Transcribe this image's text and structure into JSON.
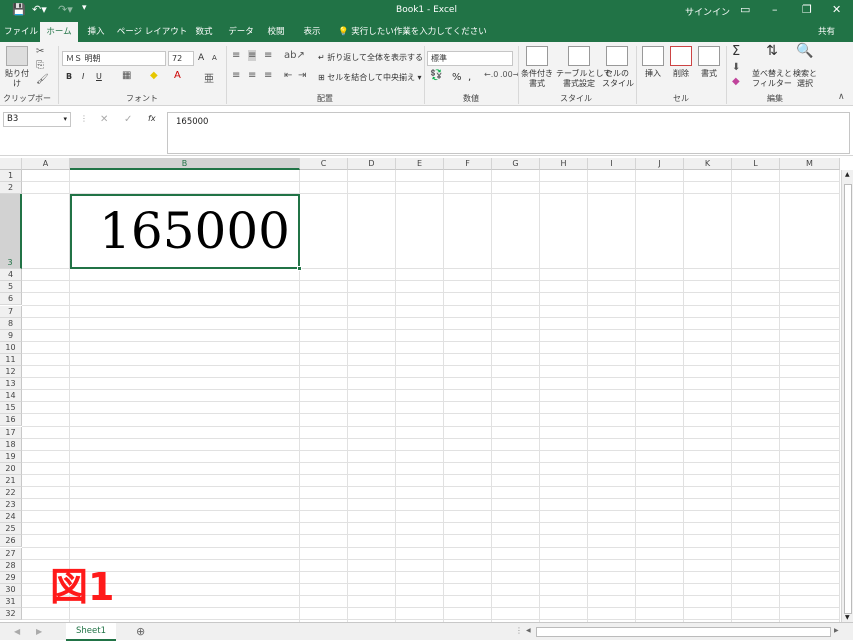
{
  "titlebar": {
    "title": "Book1  -  Excel",
    "signin": "サインイン",
    "save_icon": "save-icon",
    "undo_icon": "undo-icon",
    "redo_icon": "redo-icon",
    "customize_icon": "customize-qat-icon"
  },
  "tabs": [
    "ファイル",
    "ホーム",
    "挿入",
    "ページ レイアウト",
    "数式",
    "データ",
    "校閲",
    "表示"
  ],
  "active_tab": "ホーム",
  "tellme": "実行したい作業を入力してください",
  "share": "共有",
  "ribbon": {
    "clipboard": {
      "label": "クリップボード",
      "paste": "貼り付け"
    },
    "font": {
      "label": "フォント",
      "name": "ＭＳ 明朝",
      "size": "72",
      "bold": "B",
      "italic": "I",
      "underline": "U",
      "grow": "A",
      "shrink": "A"
    },
    "alignment": {
      "label": "配置",
      "wrap": "折り返して全体を表示する",
      "merge": "セルを結合して中央揃え"
    },
    "number": {
      "label": "数値",
      "format": "標準",
      "percent": "%",
      "comma": ","
    },
    "styles": {
      "label": "スタイル",
      "conditional": "条件付き\n書式",
      "table": "テーブルとして\n書式設定",
      "cell": "セルの\nスタイル"
    },
    "cells": {
      "label": "セル",
      "insert": "挿入",
      "delete": "削除",
      "format": "書式"
    },
    "editing": {
      "label": "編集",
      "sum": "Σ",
      "sort": "並べ替えと\nフィルター",
      "find": "検索と\n選択"
    }
  },
  "formula_bar": {
    "name_box": "B3",
    "fx": "fx",
    "cancel": "✕",
    "enter": "✓",
    "value": "165000"
  },
  "columns": [
    "A",
    "B",
    "C",
    "D",
    "E",
    "F",
    "G",
    "H",
    "I",
    "J",
    "K",
    "L",
    "M"
  ],
  "selected_column": "B",
  "rows": [
    "1",
    "2",
    "3",
    "4",
    "5",
    "6",
    "7",
    "8",
    "9",
    "10",
    "11",
    "12",
    "13",
    "14",
    "15",
    "16",
    "17",
    "18",
    "19",
    "20",
    "21",
    "22",
    "23",
    "24",
    "25",
    "26",
    "27",
    "28",
    "29",
    "30",
    "31",
    "32"
  ],
  "selected_row": "3",
  "cell_b3": "165000",
  "figure_label": "図1",
  "sheet_tab": "Sheet1",
  "add_sheet": "⊕",
  "accent": "#217346",
  "figure_color": "#ff1a1a"
}
